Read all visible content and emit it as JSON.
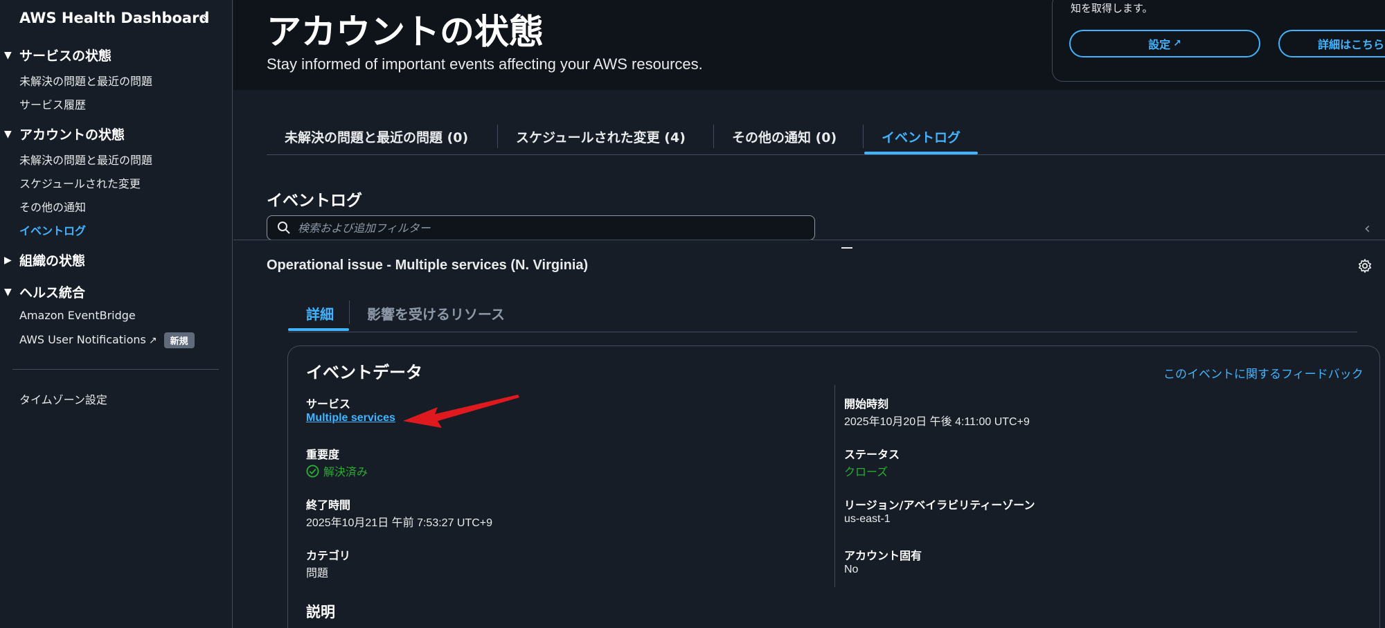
{
  "sidebar": {
    "title": "AWS Health Dashboard",
    "service_health": {
      "heading": "サービスの状態",
      "items": [
        "未解決の問題と最近の問題",
        "サービス履歴"
      ]
    },
    "account_health": {
      "heading": "アカウントの状態",
      "items": [
        "未解決の問題と最近の問題",
        "スケジュールされた変更",
        "その他の通知",
        "イベントログ"
      ]
    },
    "org_health": {
      "heading": "組織の状態"
    },
    "health_integrations": {
      "heading": "ヘルス統合",
      "items": [
        "Amazon EventBridge",
        "AWS User Notifications"
      ],
      "new_badge": "新規"
    },
    "timezone": "タイムゾーン設定"
  },
  "header": {
    "title": "アカウントの状態",
    "subtitle": "Stay informed of important events affecting your AWS resources.",
    "info_text": "知を取得します。",
    "settings_button": "設定",
    "details_button": "詳細はこちら"
  },
  "tabs": [
    "未解決の問題と最近の問題 (0)",
    "スケジュールされた変更 (4)",
    "その他の通知 (0)",
    "イベントログ"
  ],
  "event_log": {
    "title": "イベントログ",
    "search_placeholder": "検索および追加フィルター"
  },
  "detail": {
    "event_title": "Operational issue - Multiple services (N. Virginia)",
    "tabs": [
      "詳細",
      "影響を受けるリソース"
    ],
    "card_title": "イベントデータ",
    "feedback_link": "このイベントに関するフィードバック",
    "left_fields": [
      {
        "label": "サービス",
        "value": "Multiple services"
      },
      {
        "label": "重要度",
        "value": "解決済み"
      },
      {
        "label": "終了時間",
        "value": "2025年10月21日 午前 7:53:27 UTC+9"
      },
      {
        "label": "カテゴリ",
        "value": "問題"
      }
    ],
    "right_fields": [
      {
        "label": "開始時刻",
        "value": "2025年10月20日 午後 4:11:00 UTC+9"
      },
      {
        "label": "ステータス",
        "value": "クローズ"
      },
      {
        "label": "リージョン/アベイラビリティーゾーン",
        "value": "us-east-1"
      },
      {
        "label": "アカウント固有",
        "value": "No"
      }
    ],
    "description_label": "説明"
  },
  "colors": {
    "accent": "#42b4ff",
    "success": "#29ad32",
    "annotation_arrow": "#e0191f"
  }
}
